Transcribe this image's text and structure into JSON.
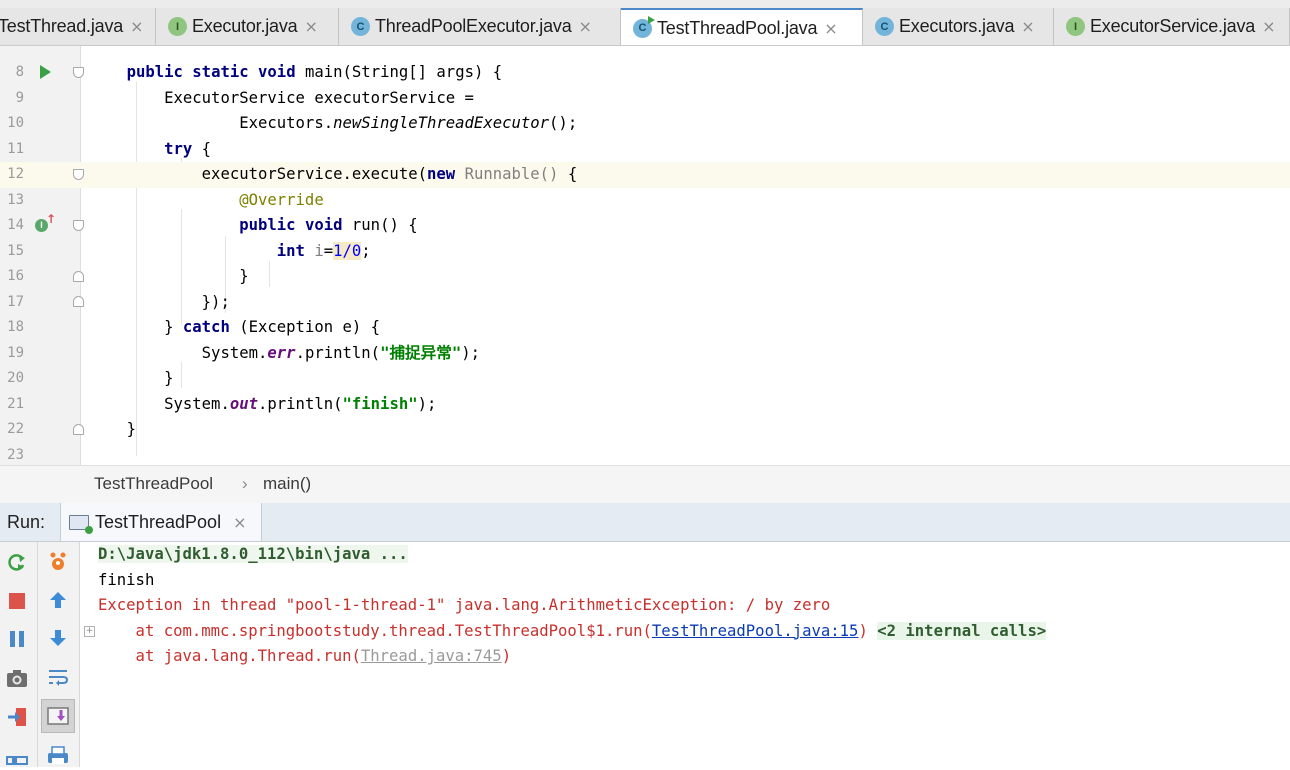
{
  "tabs": [
    {
      "label": "TestThread.java",
      "icon": "none",
      "active": false
    },
    {
      "label": "Executor.java",
      "icon": "interface-icon",
      "active": false
    },
    {
      "label": "ThreadPoolExecutor.java",
      "icon": "class-icon",
      "active": false
    },
    {
      "label": "TestThreadPool.java",
      "icon": "runnable-class-icon",
      "active": true
    },
    {
      "label": "Executors.java",
      "icon": "class-icon",
      "active": false
    },
    {
      "label": "ExecutorService.java",
      "icon": "interface-icon",
      "active": false
    }
  ],
  "tab_close_glyph": "×",
  "editor": {
    "line_numbers": [
      "8",
      "9",
      "10",
      "11",
      "12",
      "13",
      "14",
      "15",
      "16",
      "17",
      "18",
      "19",
      "20",
      "21",
      "22",
      "23"
    ],
    "tokens": {
      "l8": [
        "public",
        "static",
        "void",
        " main(String[] args) {"
      ],
      "l9": "ExecutorService executorService =",
      "l10": [
        "Executors.",
        "newSingleThreadExecutor",
        "();"
      ],
      "l11": [
        "try",
        " {"
      ],
      "l12": [
        "executorService.execute(",
        "new",
        "Runnable()",
        " {"
      ],
      "l13": "@Override",
      "l14": [
        "public",
        "void",
        " run() {"
      ],
      "l15": [
        "int",
        "i",
        "=",
        "1/0",
        ";"
      ],
      "l16": "}",
      "l17": "});",
      "l18": [
        "}",
        "catch",
        " (Exception e) {"
      ],
      "l19": [
        "System.",
        "err",
        ".println(",
        "\"捕捉异常\"",
        ");"
      ],
      "l20": "}",
      "l21": [
        "System.",
        "out",
        ".println(",
        "\"finish\"",
        ");"
      ],
      "l22": "}"
    }
  },
  "breadcrumb": {
    "class_name": "TestThreadPool",
    "separator": "›",
    "method": "main()"
  },
  "run_panel": {
    "label": "Run:",
    "tab_label": "TestThreadPool"
  },
  "console": {
    "cmd": "D:\\Java\\jdk1.8.0_112\\bin\\java ...",
    "finish": "finish",
    "exception": "Exception in thread \"pool-1-thread-1\" java.lang.ArithmeticException: / by zero",
    "trace1_prefix": "    at com.mmc.springbootstudy.thread.TestThreadPool$1.run(",
    "trace1_link": "TestThreadPool.java:15",
    "trace1_suffix": ")",
    "trace1_internal": "<2 internal calls>",
    "trace2_prefix": "    at java.lang.Thread.run(",
    "trace2_link": "Thread.java:745",
    "trace2_suffix": ")",
    "expand_glyph": "+"
  },
  "colors": {
    "keyword": "#000080",
    "string": "#008000",
    "annotation": "#808000",
    "static_field": "#660e7a",
    "error_text": "#c7302c",
    "link": "#0b3bb3"
  }
}
